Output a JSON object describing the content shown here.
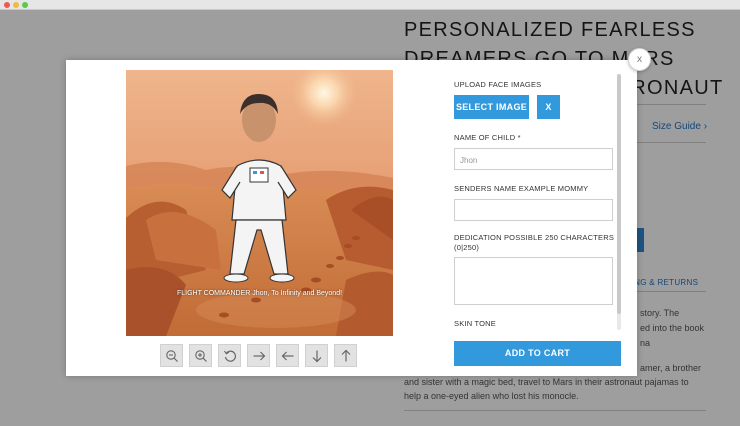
{
  "page": {
    "product_title": "PERSONALIZED FEARLESS DREAMERS GO TO MARS WITH MATCHING ASTRONAUT",
    "size_guide": "Size Guide",
    "shipping_returns": "PING & RETURNS",
    "desc_line1": "story. The",
    "desc_line2": "ed into the book",
    "desc_line3": "na",
    "desc_line4": "amer, a brother",
    "desc_line5": "and sister with a magic bed, travel to Mars in their astronaut pajamas to",
    "desc_line6": "help a one-eyed alien who lost his monocle."
  },
  "modal": {
    "close_label": "X",
    "preview_caption": "FLIGHT COMMANDER Jhon, To Infinity and Beyond!",
    "upload_label": "UPLOAD FACE IMAGES",
    "select_image_label": "SELECT IMAGE",
    "remove_image_label": "X",
    "child_name_label": "NAME OF CHILD *",
    "child_name_value": "Jhon",
    "sender_label": "SENDERS NAME EXAMPLE MOMMY",
    "sender_value": "",
    "dedication_label": "DEDICATION POSSIBLE 250 CHARACTERS",
    "dedication_counter": "(0|250)",
    "dedication_value": "",
    "skin_tone_label": "SKIN TONE",
    "add_to_cart_label": "ADD TO CART"
  },
  "tools": [
    "zoom-out-icon",
    "zoom-in-icon",
    "rotate-icon",
    "arrow-right-icon",
    "arrow-left-icon",
    "arrow-down-icon",
    "arrow-up-icon"
  ],
  "colors": {
    "accent": "#3399dd",
    "sky": "#e9a87a",
    "ground": "#c9793f",
    "link": "#1f73c8"
  }
}
